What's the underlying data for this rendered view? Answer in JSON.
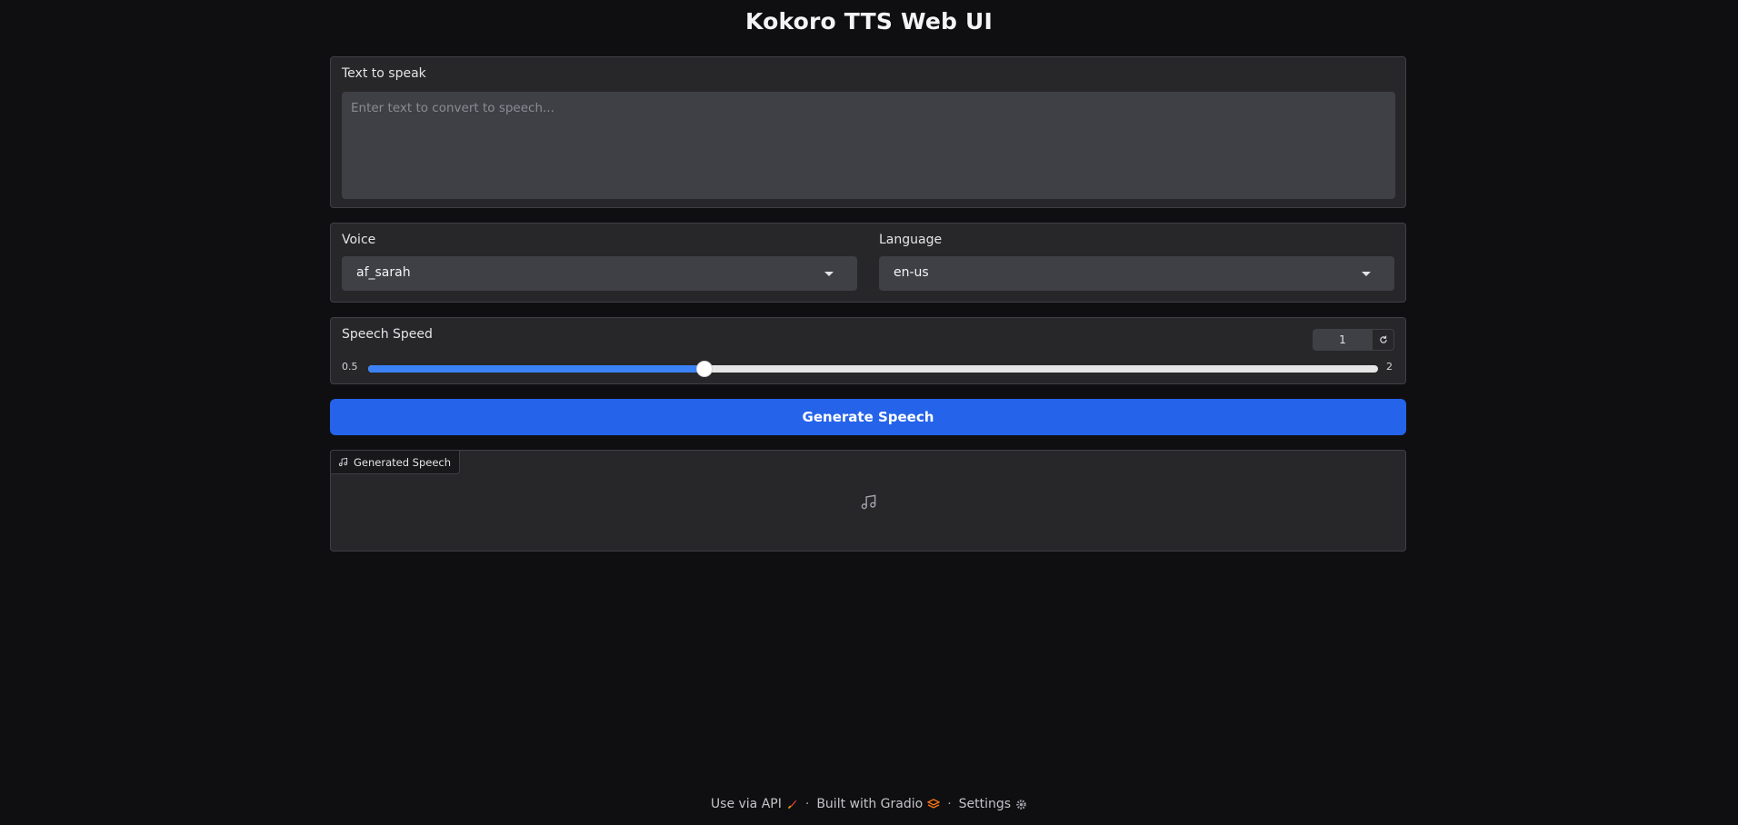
{
  "header": {
    "title": "Kokoro TTS Web UI"
  },
  "text_input": {
    "label": "Text to speak",
    "placeholder": "Enter text to convert to speech...",
    "value": ""
  },
  "voice": {
    "label": "Voice",
    "selected": "af_sarah"
  },
  "language": {
    "label": "Language",
    "selected": "en-us"
  },
  "speed": {
    "label": "Speech Speed",
    "value": "1",
    "min_label": "0.5",
    "max_label": "2",
    "min": 0.5,
    "max": 2,
    "current": 1
  },
  "generate": {
    "label": "Generate Speech"
  },
  "output": {
    "label": "Generated Speech",
    "icon": "music-note-icon"
  },
  "footer": {
    "api": "Use via API",
    "built": "Built with Gradio",
    "settings": "Settings",
    "separator": "·"
  },
  "colors": {
    "accent": "#2563eb",
    "slider_fill": "#3b82f6",
    "background": "#0f0f11",
    "panel": "#27272a"
  }
}
